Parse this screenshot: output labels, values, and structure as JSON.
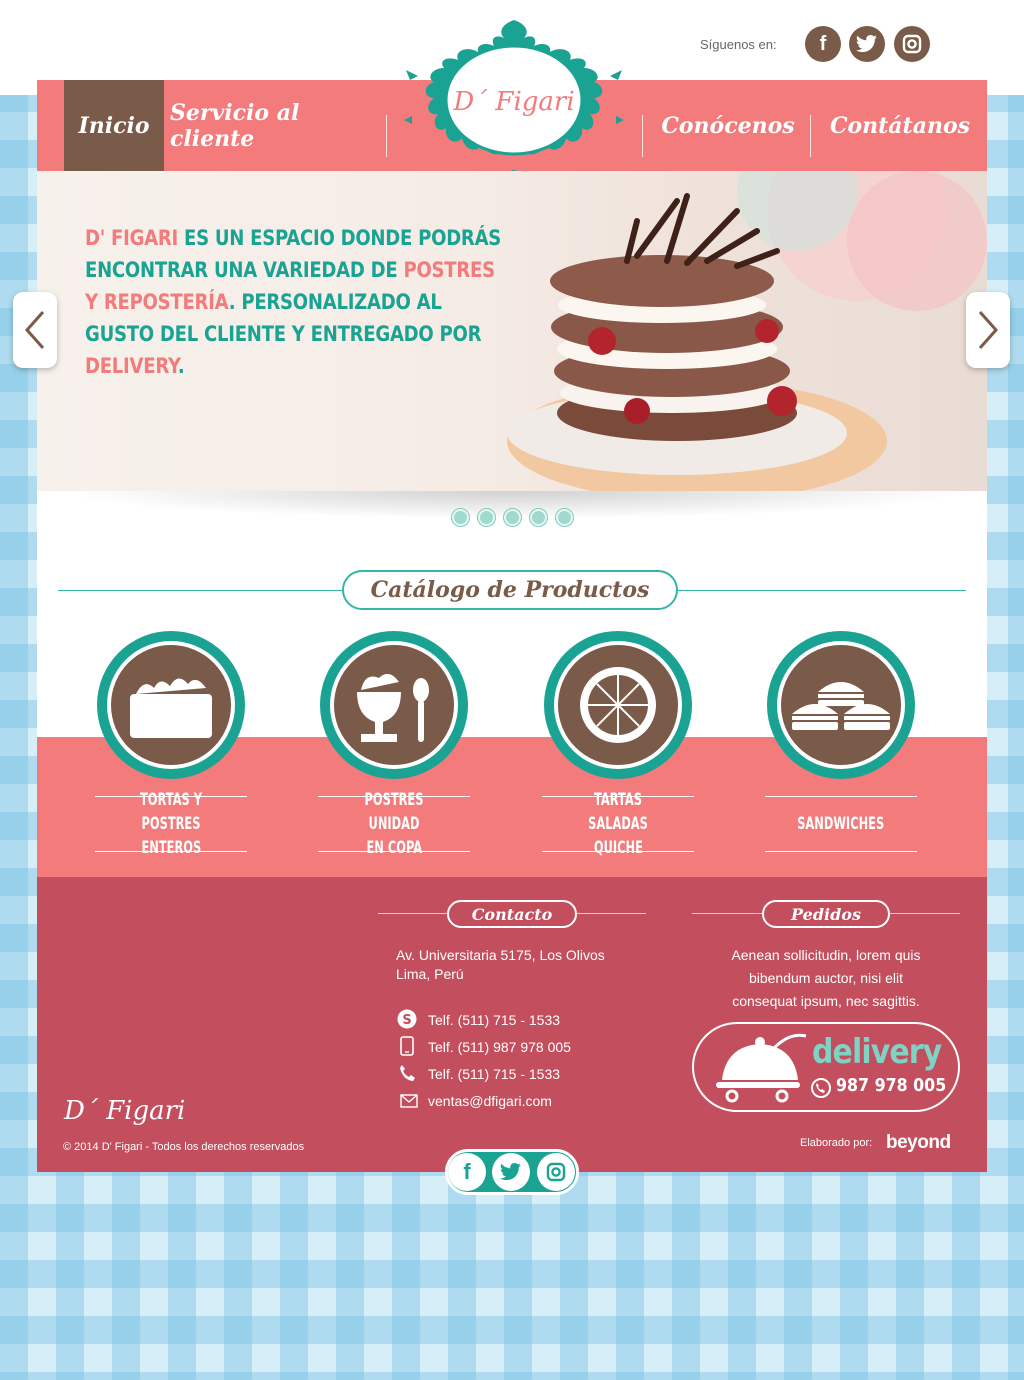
{
  "header": {
    "follow_label": "Síguenos en:",
    "social": [
      "facebook-icon",
      "twitter-icon",
      "instagram-icon"
    ],
    "logo_text": "D´ Figari"
  },
  "nav": {
    "items": [
      {
        "label": "Inicio",
        "active": true
      },
      {
        "label": "Servicio al cliente",
        "active": false
      },
      {
        "label": "Conócenos",
        "active": false
      },
      {
        "label": "Contátanos",
        "active": false
      }
    ]
  },
  "hero": {
    "segments": [
      {
        "text": "D' Figari",
        "pink": true
      },
      {
        "text": " es un espacio donde podrás encontrar una variedad de ",
        "pink": false
      },
      {
        "text": "postres y repostería",
        "pink": true
      },
      {
        "text": ". Personalizado al gusto del cliente y entregado por ",
        "pink": false
      },
      {
        "text": "delivery",
        "pink": true
      },
      {
        "text": ".",
        "pink": false
      }
    ],
    "slides": 5,
    "active_slide": 1
  },
  "catalog": {
    "title": "Catálogo de Productos",
    "items": [
      {
        "line1": "TORTAS Y POSTRES",
        "line2": "ENTEROS",
        "icon": "cake-icon"
      },
      {
        "line1": "POSTRES UNIDAD",
        "line2": "EN COPA",
        "icon": "cup-dessert-icon"
      },
      {
        "line1": "TARTAS SALADAS",
        "line2": "QUICHE",
        "icon": "pie-icon"
      },
      {
        "line1": "SANDWICHES",
        "line2": "",
        "icon": "sandwich-icon"
      }
    ]
  },
  "footer": {
    "contact_title": "Contacto",
    "address_line1": "Av. Universitaria 5175, Los Olivos",
    "address_line2": "Lima, Perú",
    "contacts": [
      {
        "icon": "skype-icon",
        "text": "Telf. (511) 715 - 1533"
      },
      {
        "icon": "mobile-icon",
        "text": "Telf. (511) 987 978 005"
      },
      {
        "icon": "phone-icon",
        "text": "Telf. (511) 715 - 1533"
      },
      {
        "icon": "mail-icon",
        "text": "ventas@dfigari.com"
      }
    ],
    "orders_title": "Pedidos",
    "orders_line1": "Aenean sollicitudin, lorem quis",
    "orders_line2": "bibendum auctor, nisi elit",
    "orders_line3": "consequat ipsum, nec sagittis.",
    "delivery_word": "delivery",
    "delivery_phone": "987 978 005",
    "logo_text": "D´ Figari",
    "copyright": "© 2014 D' Figari - Todos los derechos reservados",
    "made_by_label": "Elaborado por:",
    "made_by_brand": "beyond"
  },
  "colors": {
    "pink": "#f37b7b",
    "teal": "#1aa393",
    "brown": "#7a5a48",
    "footer": "#c34f5e"
  }
}
